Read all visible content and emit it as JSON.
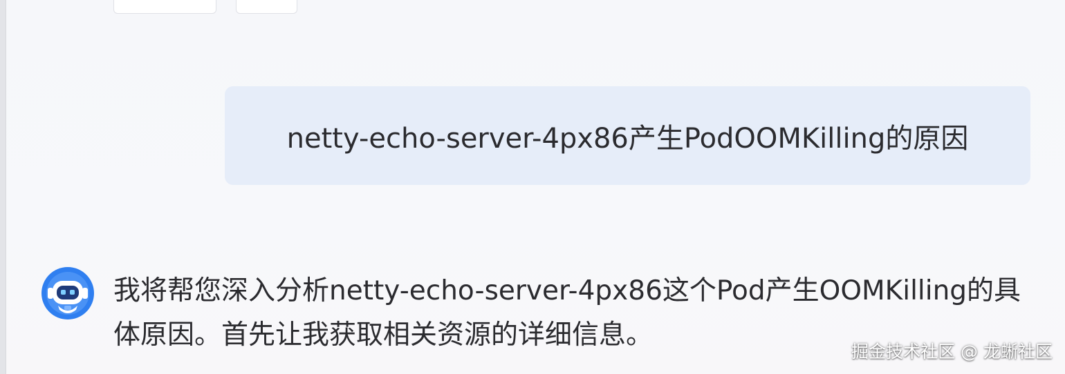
{
  "chat": {
    "top_buttons": [
      "",
      ""
    ],
    "user_message": "netty-echo-server-4px86产生PodOOMKilling的原因",
    "assistant_message": "我将帮您深入分析netty-echo-server-4px86这个Pod产生OOMKilling的具体原因。首先让我获取相关资源的详细信息。"
  },
  "icons": {
    "assistant_avatar": "robot-avatar-icon"
  },
  "watermark": "掘金技术社区 @ 龙蜥社区",
  "colors": {
    "user_bubble_bg": "#e6edf9",
    "text": "#2b2b2f",
    "avatar_blue": "#2f7ff0"
  }
}
